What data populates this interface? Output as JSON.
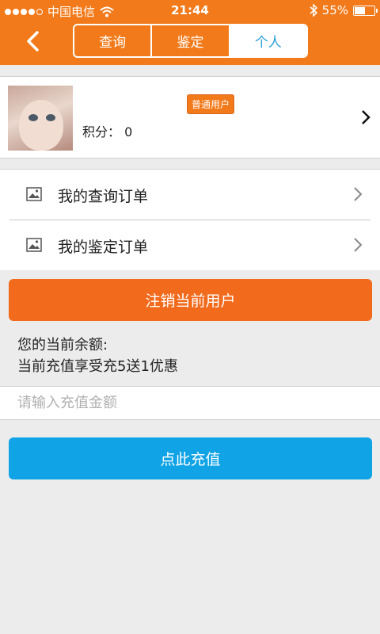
{
  "status_bar": {
    "carrier": "中国电信",
    "time": "21:44",
    "battery": "55%",
    "battery_level": 0.55
  },
  "header": {
    "tabs": [
      "查询",
      "鉴定",
      "个人"
    ],
    "active_tab": "个人"
  },
  "profile": {
    "user_type": "普通用户",
    "points_label": "积分：",
    "points_value": "0"
  },
  "menu": {
    "items": [
      {
        "label": "我的查询订单"
      },
      {
        "label": "我的鉴定订单"
      }
    ]
  },
  "logout_label": "注销当前用户",
  "balance": {
    "label": "您的当前余额:",
    "promo": "当前充值享受充5送1优惠"
  },
  "recharge": {
    "placeholder": "请输入充值金额",
    "button_label": "点此充值"
  },
  "colors": {
    "brand_orange": "#f27a1a",
    "button_orange": "#f26a1b",
    "button_blue": "#10a3e6",
    "active_tab_text": "#2b9fd6"
  }
}
